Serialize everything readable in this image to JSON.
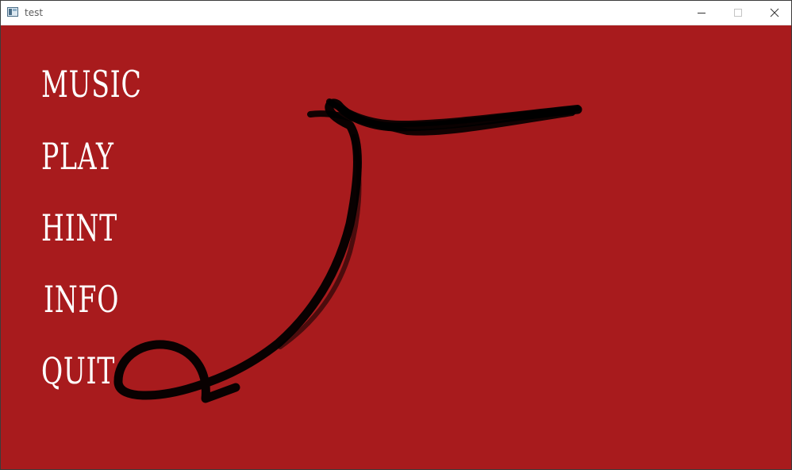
{
  "window": {
    "title": "test",
    "app_icon": "app-window-icon",
    "controls": {
      "minimize_icon": "minimize-icon",
      "maximize_icon": "maximize-icon",
      "close_icon": "close-icon"
    }
  },
  "canvas": {
    "background_color": "#a81b1d",
    "text_color": "#ffffff",
    "stroke_color": "#000000"
  },
  "menu": {
    "items": [
      {
        "label": "MUSIC"
      },
      {
        "label": "PLAY"
      },
      {
        "label": "HINT"
      },
      {
        "label": "INFO"
      },
      {
        "label": "QUIT"
      }
    ]
  }
}
